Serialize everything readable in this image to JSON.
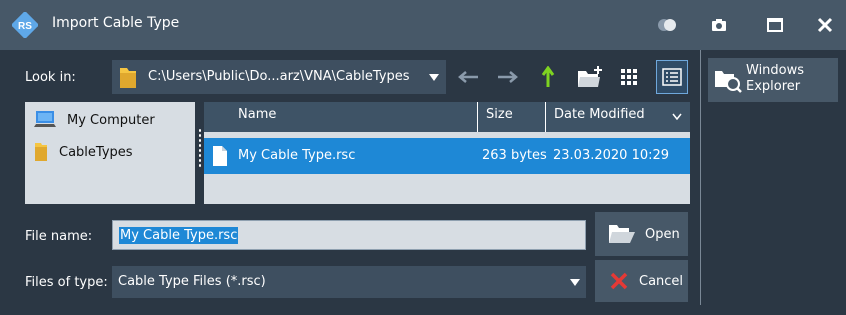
{
  "window": {
    "title": "Import Cable Type"
  },
  "look_in": {
    "label": "Look in:",
    "path": "C:\\Users\\Public\\Do...arz\\VNA\\CableTypes"
  },
  "toolbar": {
    "icons": [
      "back-arrow-icon",
      "forward-arrow-icon",
      "up-arrow-icon",
      "new-folder-icon",
      "list-view-icon",
      "detail-view-icon"
    ]
  },
  "places": [
    {
      "label": "My Computer",
      "icon": "computer-icon"
    },
    {
      "label": "CableTypes",
      "icon": "folder-icon"
    }
  ],
  "file_table": {
    "columns": [
      "Name",
      "Size",
      "Date Modified"
    ],
    "rows": [
      {
        "name": "My Cable Type.rsc",
        "size": "263 bytes",
        "modified": "23.03.2020 10:29",
        "selected": true
      }
    ]
  },
  "file_name": {
    "label": "File name:",
    "value": "My Cable Type.rsc"
  },
  "files_of_type": {
    "label": "Files of type:",
    "value": "Cable Type Files (*.rsc)"
  },
  "buttons": {
    "open": "Open",
    "cancel": "Cancel",
    "windows_explorer_line1": "Windows",
    "windows_explorer_line2": "Explorer"
  },
  "colors": {
    "titlebar": "#475868",
    "background": "#2b3744",
    "selection": "#1e88d6",
    "up_arrow": "#7ed321",
    "cancel_x": "#e53935",
    "folder": "#f5c542"
  }
}
